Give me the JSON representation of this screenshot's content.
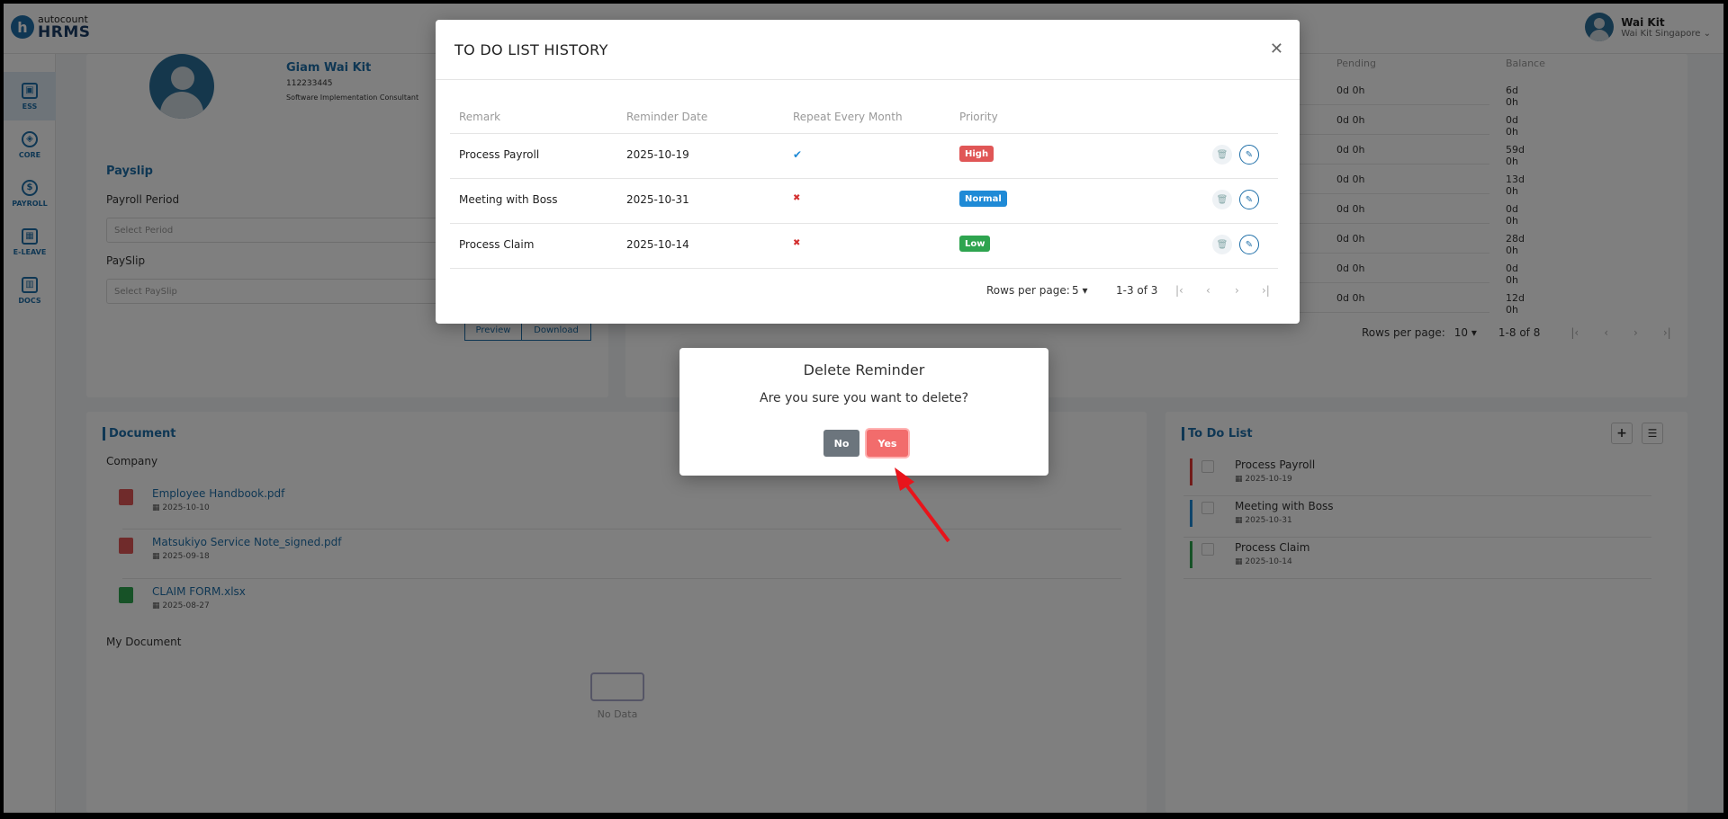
{
  "header": {
    "logo_small": "autocount",
    "logo_big": "HRMS",
    "user_name": "Wai Kit",
    "user_company": "Wai Kit Singapore"
  },
  "sidebar": {
    "items": [
      {
        "label": "ESS",
        "icon": "ess-icon"
      },
      {
        "label": "CORE",
        "icon": "core-icon"
      },
      {
        "label": "PAYROLL",
        "icon": "payroll-icon"
      },
      {
        "label": "E-LEAVE",
        "icon": "calendar-icon"
      },
      {
        "label": "DOCS",
        "icon": "docs-icon"
      }
    ]
  },
  "profile": {
    "name": "Giam Wai Kit",
    "id": "112233445",
    "role": "Software Implementation Consultant"
  },
  "payslip": {
    "title": "Payslip",
    "period_label": "Payroll Period",
    "period_placeholder": "Select Period",
    "payslip_label": "PaySlip",
    "payslip_placeholder": "Select PaySlip",
    "preview": "Preview",
    "download": "Download"
  },
  "leave": {
    "headers": [
      "Pending",
      "Balance"
    ],
    "rows": [
      [
        "0d 0h",
        "6d 0h"
      ],
      [
        "0d 0h",
        "0d 0h"
      ],
      [
        "0d 0h",
        "59d 0h"
      ],
      [
        "0d 0h",
        "13d 0h"
      ],
      [
        "0d 0h",
        "0d 0h"
      ],
      [
        "0d 0h",
        "28d 0h"
      ],
      [
        "0d 0h",
        "0d 0h"
      ],
      [
        "0d 0h",
        "12d 0h"
      ]
    ],
    "rows_per_page_label": "Rows per page:",
    "rows_per_page": "10",
    "range": "1-8 of 8"
  },
  "document": {
    "title": "Document",
    "company_label": "Company",
    "files": [
      {
        "name": "Employee Handbook.pdf",
        "date": "2025-10-10"
      },
      {
        "name": "Matsukiyo Service Note_signed.pdf",
        "date": "2025-09-18"
      },
      {
        "name": "CLAIM FORM.xlsx",
        "date": "2025-08-27"
      }
    ],
    "my_document_label": "My Document",
    "no_data": "No Data"
  },
  "todo": {
    "title": "To Do List",
    "items": [
      {
        "title": "Process Payroll",
        "date": "2025-10-19",
        "color": "#e53935"
      },
      {
        "title": "Meeting with Boss",
        "date": "2025-10-31",
        "color": "#1f8ad6"
      },
      {
        "title": "Process Claim",
        "date": "2025-10-14",
        "color": "#2ea44f"
      }
    ]
  },
  "history_modal": {
    "title": "TO DO LIST HISTORY",
    "headers": [
      "Remark",
      "Reminder Date",
      "Repeat Every Month",
      "Priority"
    ],
    "rows": [
      {
        "remark": "Process Payroll",
        "date": "2025-10-19",
        "repeat": "✔",
        "priority": "High",
        "priority_color": "#e05656"
      },
      {
        "remark": "Meeting with Boss",
        "date": "2025-10-31",
        "repeat": "✖",
        "priority": "Normal",
        "priority_color": "#1f8ad6"
      },
      {
        "remark": "Process Claim",
        "date": "2025-10-14",
        "repeat": "✖",
        "priority": "Low",
        "priority_color": "#2ea44f"
      }
    ],
    "rows_per_page_label": "Rows per page:",
    "rows_per_page": "5",
    "range": "1-3 of 3"
  },
  "confirm_dialog": {
    "title": "Delete Reminder",
    "message": "Are you sure you want to delete?",
    "no": "No",
    "yes": "Yes"
  }
}
